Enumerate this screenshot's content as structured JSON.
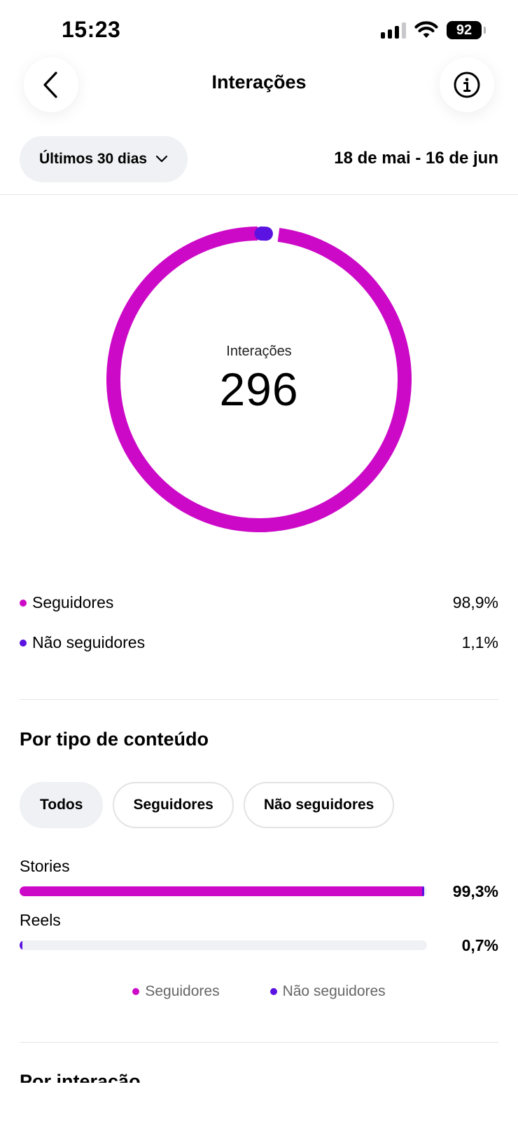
{
  "status_bar": {
    "time": "15:23",
    "battery": "92"
  },
  "header": {
    "title": "Interações"
  },
  "filter": {
    "period_label": "Últimos 30 dias",
    "date_range": "18 de mai - 16 de jun"
  },
  "colors": {
    "followers": "#cc09c7",
    "non_followers": "#5a13e0",
    "track": "#eff1f4"
  },
  "icons": {
    "back": "chevron-left-icon",
    "info": "info-icon",
    "dropdown": "chevron-down-icon"
  },
  "summary": {
    "label": "Interações",
    "total": "296",
    "followers_fraction": 0.989,
    "non_followers_fraction": 0.011,
    "legend": [
      {
        "label": "Seguidores",
        "value": "98,9%"
      },
      {
        "label": "Não seguidores",
        "value": "1,1%"
      }
    ]
  },
  "content_type": {
    "title": "Por tipo de conteúdo",
    "chips": [
      "Todos",
      "Seguidores",
      "Não seguidores"
    ],
    "selected_chip": "Todos",
    "rows": [
      {
        "label": "Stories",
        "value": "99,3%",
        "fraction": 0.993
      },
      {
        "label": "Reels",
        "value": "0,7%",
        "fraction": 0.007
      }
    ],
    "legend": [
      "Seguidores",
      "Não seguidores"
    ]
  },
  "next_section": {
    "title": "Por interação"
  }
}
